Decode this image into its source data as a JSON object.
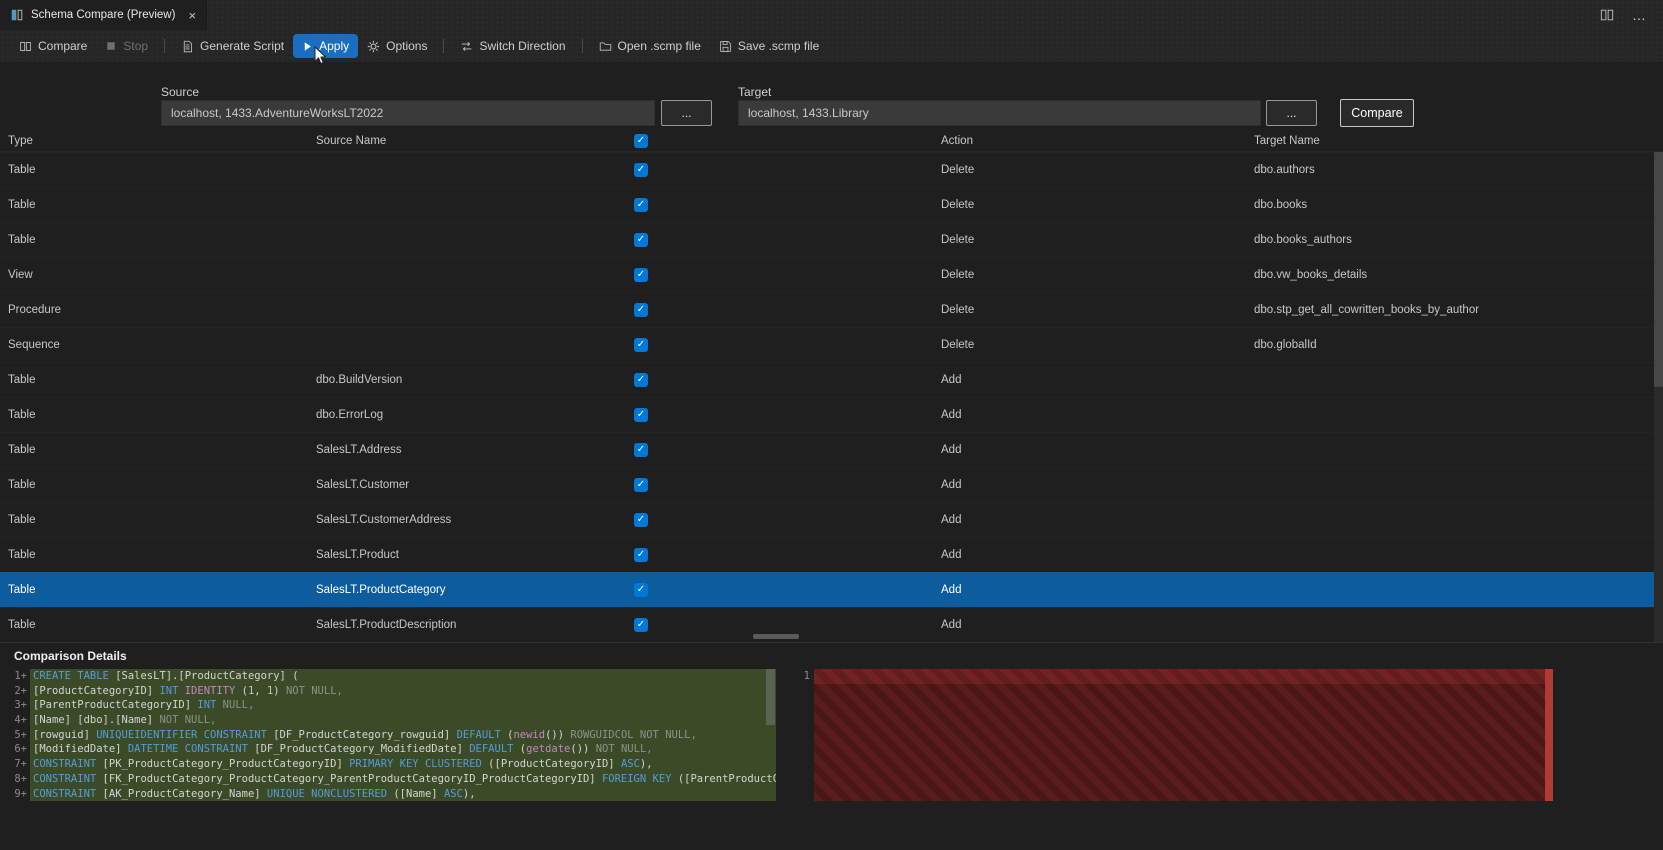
{
  "colors": {
    "selected_row": "#0d5c9e",
    "checkbox": "#0078d7",
    "apply_bg": "#1a6ec2",
    "diff_add_bg": "#3b4b27",
    "diff_del_dark": "#4a1616",
    "diff_del_light": "#5a1d1d",
    "diff_del_ruler": "#b03a34"
  },
  "tab": {
    "title": "Schema Compare (Preview)",
    "close_glyph": "×"
  },
  "window_controls": {
    "more_glyph": "…"
  },
  "toolbar": {
    "compare": "Compare",
    "stop": "Stop",
    "generate_script": "Generate Script",
    "apply": "Apply",
    "options": "Options",
    "switch_direction": "Switch Direction",
    "open_scmp": "Open .scmp file",
    "save_scmp": "Save .scmp file"
  },
  "connections": {
    "source_label": "Source",
    "source_value": "localhost, 1433.AdventureWorksLT2022",
    "target_label": "Target",
    "target_value": "localhost, 1433.Library",
    "browse_label": "...",
    "compare_button": "Compare"
  },
  "grid": {
    "check_glyph": "✓",
    "headers": {
      "type": "Type",
      "source": "Source Name",
      "action": "Action",
      "target": "Target Name"
    },
    "rows": [
      {
        "type": "Table",
        "source": "",
        "checked": true,
        "action": "Delete",
        "target": "dbo.authors",
        "selected": false
      },
      {
        "type": "Table",
        "source": "",
        "checked": true,
        "action": "Delete",
        "target": "dbo.books",
        "selected": false
      },
      {
        "type": "Table",
        "source": "",
        "checked": true,
        "action": "Delete",
        "target": "dbo.books_authors",
        "selected": false
      },
      {
        "type": "View",
        "source": "",
        "checked": true,
        "action": "Delete",
        "target": "dbo.vw_books_details",
        "selected": false
      },
      {
        "type": "Procedure",
        "source": "",
        "checked": true,
        "action": "Delete",
        "target": "dbo.stp_get_all_cowritten_books_by_author",
        "selected": false
      },
      {
        "type": "Sequence",
        "source": "",
        "checked": true,
        "action": "Delete",
        "target": "dbo.globalId",
        "selected": false
      },
      {
        "type": "Table",
        "source": "dbo.BuildVersion",
        "checked": true,
        "action": "Add",
        "target": "",
        "selected": false
      },
      {
        "type": "Table",
        "source": "dbo.ErrorLog",
        "checked": true,
        "action": "Add",
        "target": "",
        "selected": false
      },
      {
        "type": "Table",
        "source": "SalesLT.Address",
        "checked": true,
        "action": "Add",
        "target": "",
        "selected": false
      },
      {
        "type": "Table",
        "source": "SalesLT.Customer",
        "checked": true,
        "action": "Add",
        "target": "",
        "selected": false
      },
      {
        "type": "Table",
        "source": "SalesLT.CustomerAddress",
        "checked": true,
        "action": "Add",
        "target": "",
        "selected": false
      },
      {
        "type": "Table",
        "source": "SalesLT.Product",
        "checked": true,
        "action": "Add",
        "target": "",
        "selected": false
      },
      {
        "type": "Table",
        "source": "SalesLT.ProductCategory",
        "checked": true,
        "action": "Add",
        "target": "",
        "selected": true
      },
      {
        "type": "Table",
        "source": "SalesLT.ProductDescription",
        "checked": true,
        "action": "Add",
        "target": "",
        "selected": false
      }
    ]
  },
  "details": {
    "title": "Comparison Details",
    "add_marker": "+",
    "right_line_number": "1",
    "lines": [
      {
        "num": "1",
        "tokens": [
          [
            "k",
            "CREATE TABLE "
          ],
          [
            "d",
            "[SalesLT].[ProductCategory] ("
          ]
        ]
      },
      {
        "num": "2",
        "tokens": [
          [
            "d",
            "[ProductCategoryID] "
          ],
          [
            "k",
            "INT "
          ],
          [
            "f",
            "IDENTITY "
          ],
          [
            "d",
            "("
          ],
          [
            "n",
            "1"
          ],
          [
            "d",
            ", "
          ],
          [
            "n",
            "1"
          ],
          [
            "d",
            ") "
          ],
          [
            "m",
            "NOT NULL,"
          ]
        ]
      },
      {
        "num": "3",
        "tokens": [
          [
            "d",
            "[ParentProductCategoryID] "
          ],
          [
            "k",
            "INT "
          ],
          [
            "m",
            "NULL,"
          ]
        ]
      },
      {
        "num": "4",
        "tokens": [
          [
            "d",
            "[Name] [dbo].[Name] "
          ],
          [
            "m",
            "NOT NULL,"
          ]
        ]
      },
      {
        "num": "5",
        "tokens": [
          [
            "d",
            "[rowguid] "
          ],
          [
            "k",
            "UNIQUEIDENTIFIER "
          ],
          [
            "k",
            "CONSTRAINT "
          ],
          [
            "d",
            "[DF_ProductCategory_rowguid] "
          ],
          [
            "k",
            "DEFAULT "
          ],
          [
            "d",
            "("
          ],
          [
            "f",
            "newid"
          ],
          [
            "d",
            "()) "
          ],
          [
            "m",
            "ROWGUIDCOL NOT NULL,"
          ]
        ]
      },
      {
        "num": "6",
        "tokens": [
          [
            "d",
            "[ModifiedDate] "
          ],
          [
            "k",
            "DATETIME "
          ],
          [
            "k",
            "CONSTRAINT "
          ],
          [
            "d",
            "[DF_ProductCategory_ModifiedDate] "
          ],
          [
            "k",
            "DEFAULT "
          ],
          [
            "d",
            "("
          ],
          [
            "f",
            "getdate"
          ],
          [
            "d",
            "()) "
          ],
          [
            "m",
            "NOT NULL,"
          ]
        ]
      },
      {
        "num": "7",
        "tokens": [
          [
            "k",
            "CONSTRAINT "
          ],
          [
            "d",
            "[PK_ProductCategory_ProductCategoryID] "
          ],
          [
            "k",
            "PRIMARY KEY CLUSTERED "
          ],
          [
            "d",
            "([ProductCategoryID] "
          ],
          [
            "k",
            "ASC"
          ],
          [
            "d",
            "),"
          ]
        ]
      },
      {
        "num": "8",
        "tokens": [
          [
            "k",
            "CONSTRAINT "
          ],
          [
            "d",
            "[FK_ProductCategory_ProductCategory_ParentProductCategoryID_ProductCategoryID] "
          ],
          [
            "k",
            "FOREIGN KEY "
          ],
          [
            "d",
            "([ParentProductCatego"
          ]
        ]
      },
      {
        "num": "9",
        "tokens": [
          [
            "k",
            "CONSTRAINT "
          ],
          [
            "d",
            "[AK_ProductCategory_Name] "
          ],
          [
            "k",
            "UNIQUE NONCLUSTERED "
          ],
          [
            "d",
            "([Name] "
          ],
          [
            "k",
            "ASC"
          ],
          [
            "d",
            "),"
          ]
        ]
      }
    ]
  }
}
